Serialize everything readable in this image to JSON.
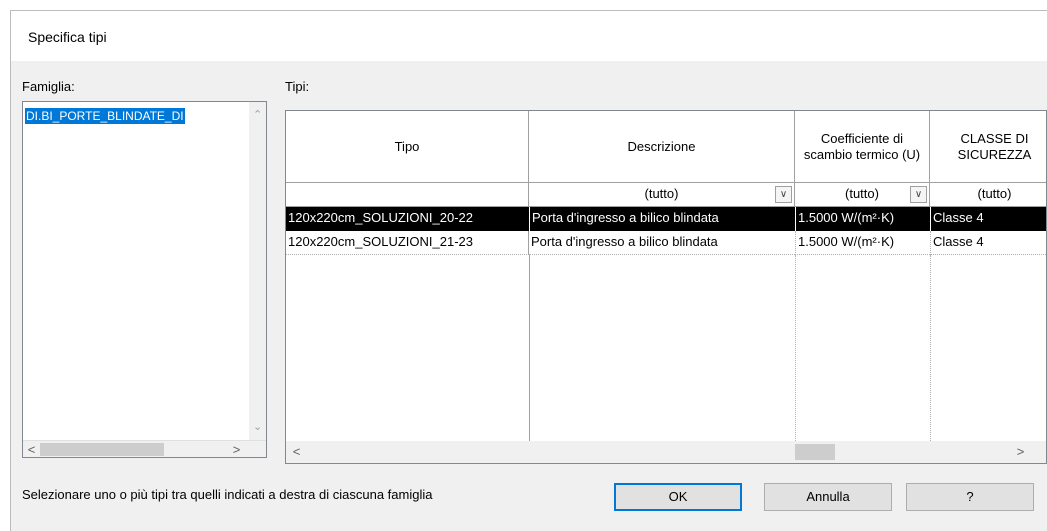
{
  "window": {
    "title": "Specifica tipi"
  },
  "family": {
    "label": "Famiglia:",
    "items": [
      "DI.BI_PORTE_BLINDATE_DI"
    ]
  },
  "types": {
    "label": "Tipi:",
    "columns": [
      {
        "header": "Tipo",
        "filter": ""
      },
      {
        "header": "Descrizione",
        "filter": "(tutto)"
      },
      {
        "header": "Coefficiente di scambio termico (U)",
        "filter": "(tutto)"
      },
      {
        "header": "CLASSE DI SICUREZZA",
        "filter": "(tutto)"
      }
    ],
    "rows": [
      {
        "tipo": "120x220cm_SOLUZIONI_20-22",
        "descrizione": "Porta d'ingresso a bilico blindata",
        "coefficiente": "1.5000 W/(m²·K)",
        "classe": "Classe 4",
        "selected": true
      },
      {
        "tipo": "120x220cm_SOLUZIONI_21-23",
        "descrizione": "Porta d'ingresso a bilico blindata",
        "coefficiente": "1.5000 W/(m²·K)",
        "classe": "Classe 4",
        "selected": false
      }
    ]
  },
  "footer": {
    "hint": "Selezionare uno o più tipi tra quelli indicati a destra di ciascuna famiglia",
    "ok_label": "OK",
    "cancel_label": "Annulla",
    "help_label": "?"
  }
}
